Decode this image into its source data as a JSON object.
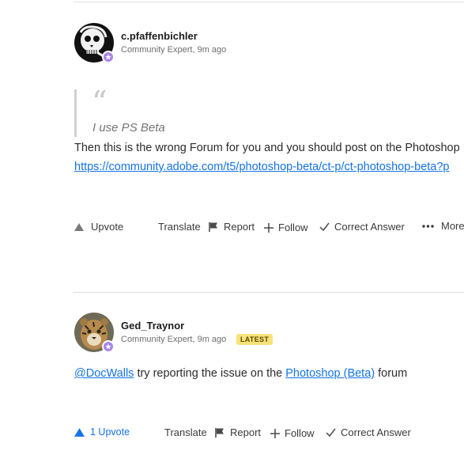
{
  "post1": {
    "username": "c.pfaffenbichler",
    "meta": "Community Expert, 9m ago",
    "quote": "I use PS Beta",
    "body_text": "Then this is the wrong Forum for you and you should post on the Photoshop",
    "link_text": "https://community.adobe.com/t5/photoshop-beta/ct-p/ct-photoshop-beta?p",
    "actions": {
      "upvote": "Upvote",
      "translate": "Translate",
      "report": "Report",
      "follow": "Follow",
      "correct": "Correct Answer",
      "more": "More"
    }
  },
  "post2": {
    "username": "Ged_Traynor",
    "meta": "Community Expert, 9m ago",
    "badge": "LATEST",
    "mention": "@DocWalls",
    "text_mid": " try reporting the issue on the ",
    "forum_link": "Photoshop (Beta)",
    "text_end": " forum",
    "actions": {
      "upvote": "1 Upvote",
      "translate": "Translate",
      "report": "Report",
      "follow": "Follow",
      "correct": "Correct Answer"
    }
  },
  "colors": {
    "accent_blue": "#1473e6",
    "badge_purple": "#a884e6",
    "latest_yellow": "#f7e27a"
  }
}
